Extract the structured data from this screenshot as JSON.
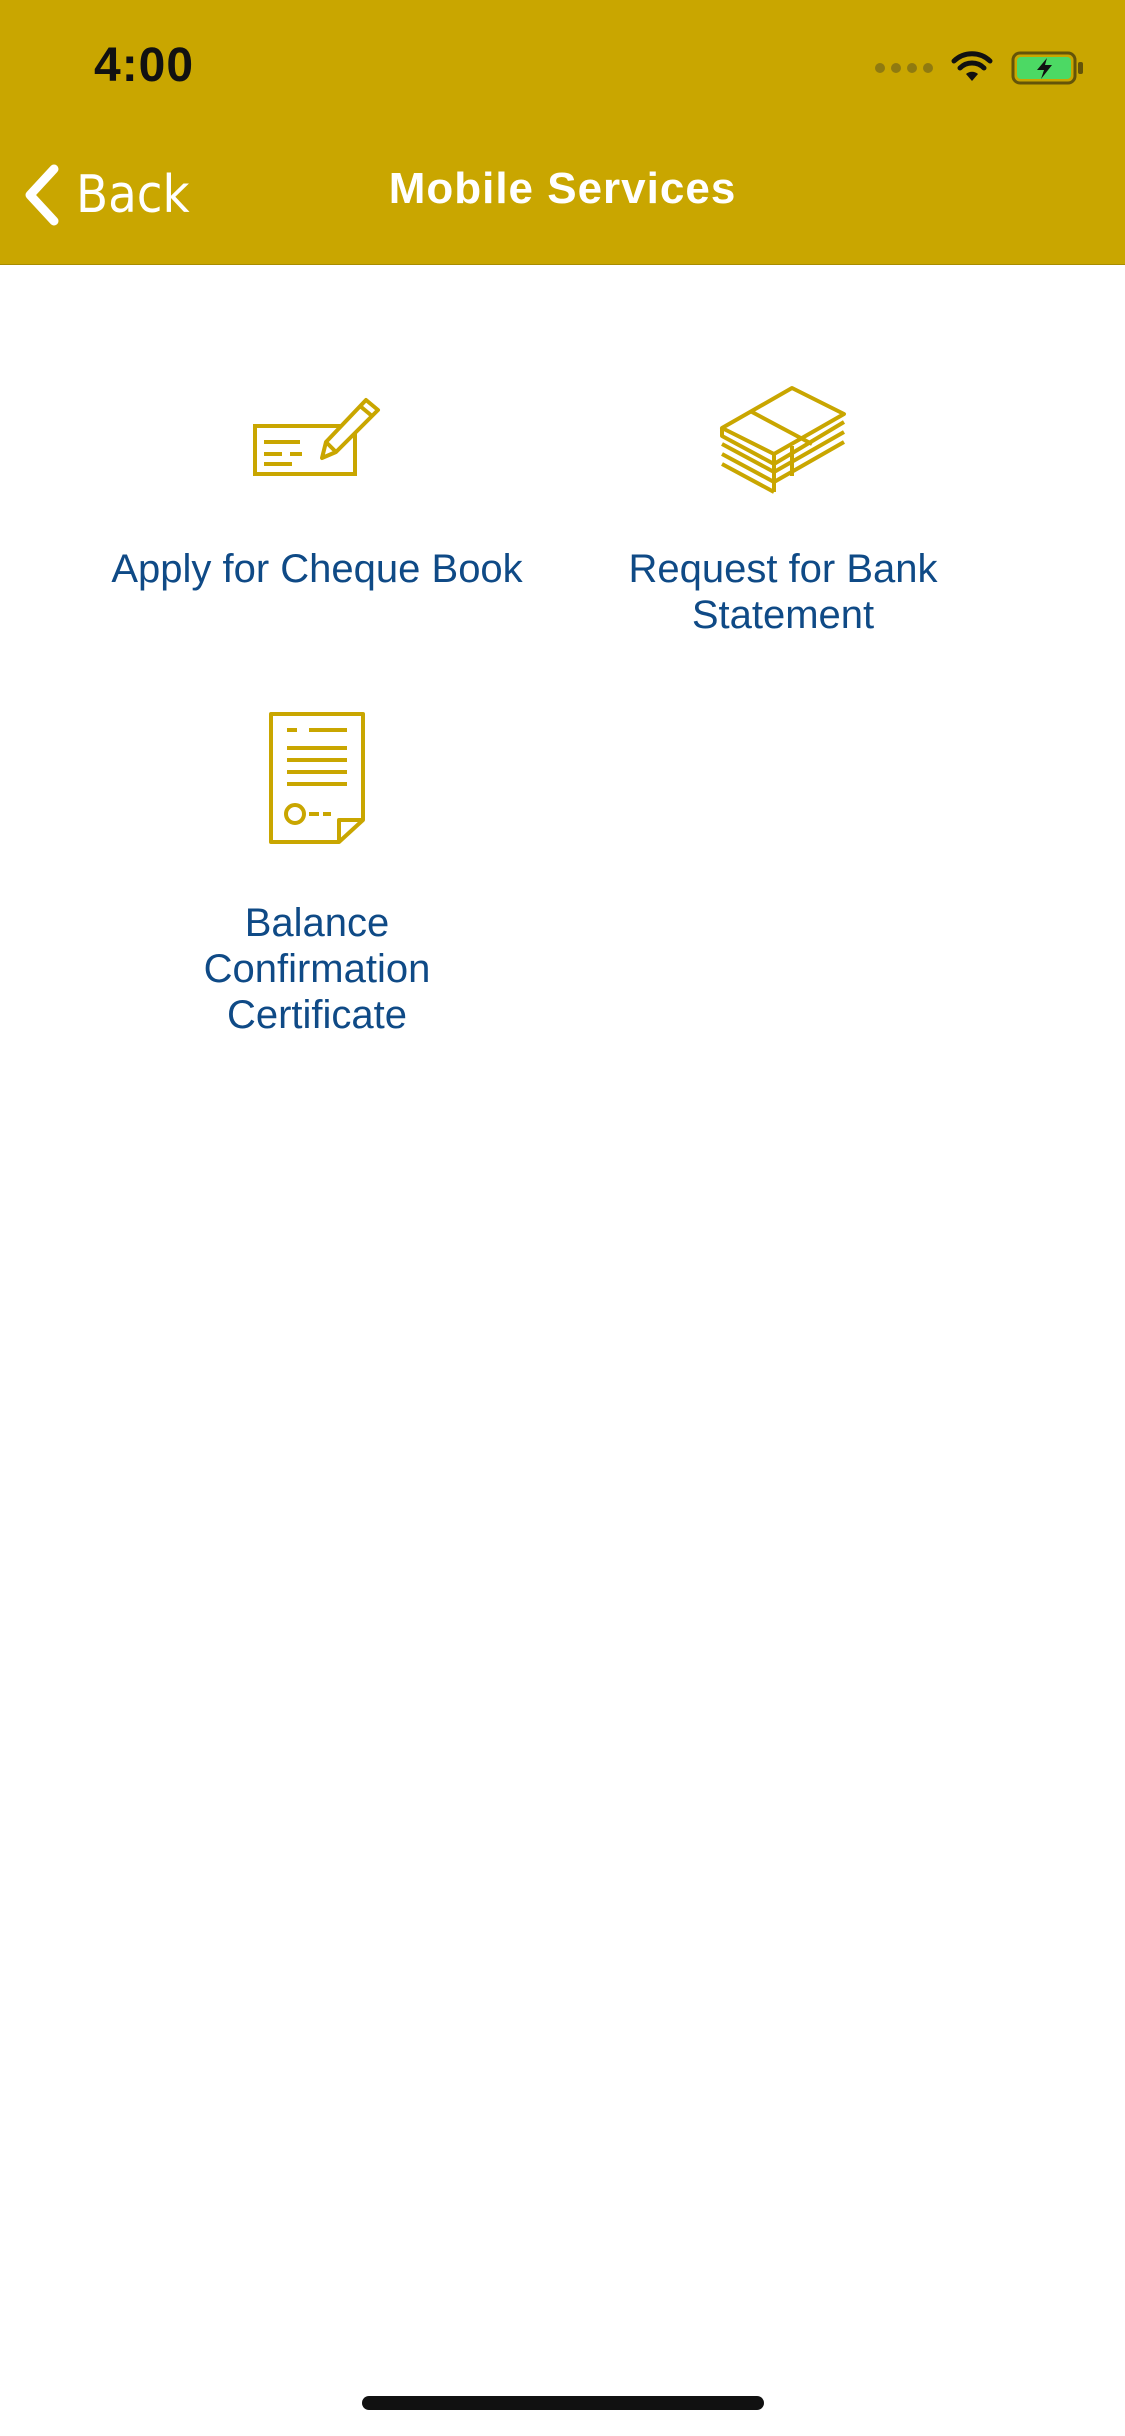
{
  "status_bar": {
    "time": "4:00",
    "icons": [
      "cellular-signal-icon",
      "wifi-icon",
      "battery-charging-icon"
    ]
  },
  "nav": {
    "back_label": "Back",
    "title": "Mobile Services"
  },
  "services": [
    {
      "label": "Apply for Cheque Book",
      "icon": "cheque-pen-icon"
    },
    {
      "label": "Request for Bank Statement",
      "icon": "stacked-documents-icon"
    },
    {
      "label": "Balance Confirmation Certificate",
      "icon": "certificate-document-icon"
    }
  ],
  "colors": {
    "header_bg": "#C9A600",
    "icon_gold": "#C9A600",
    "label_blue": "#0F4A86",
    "battery_green": "#4CD964"
  }
}
